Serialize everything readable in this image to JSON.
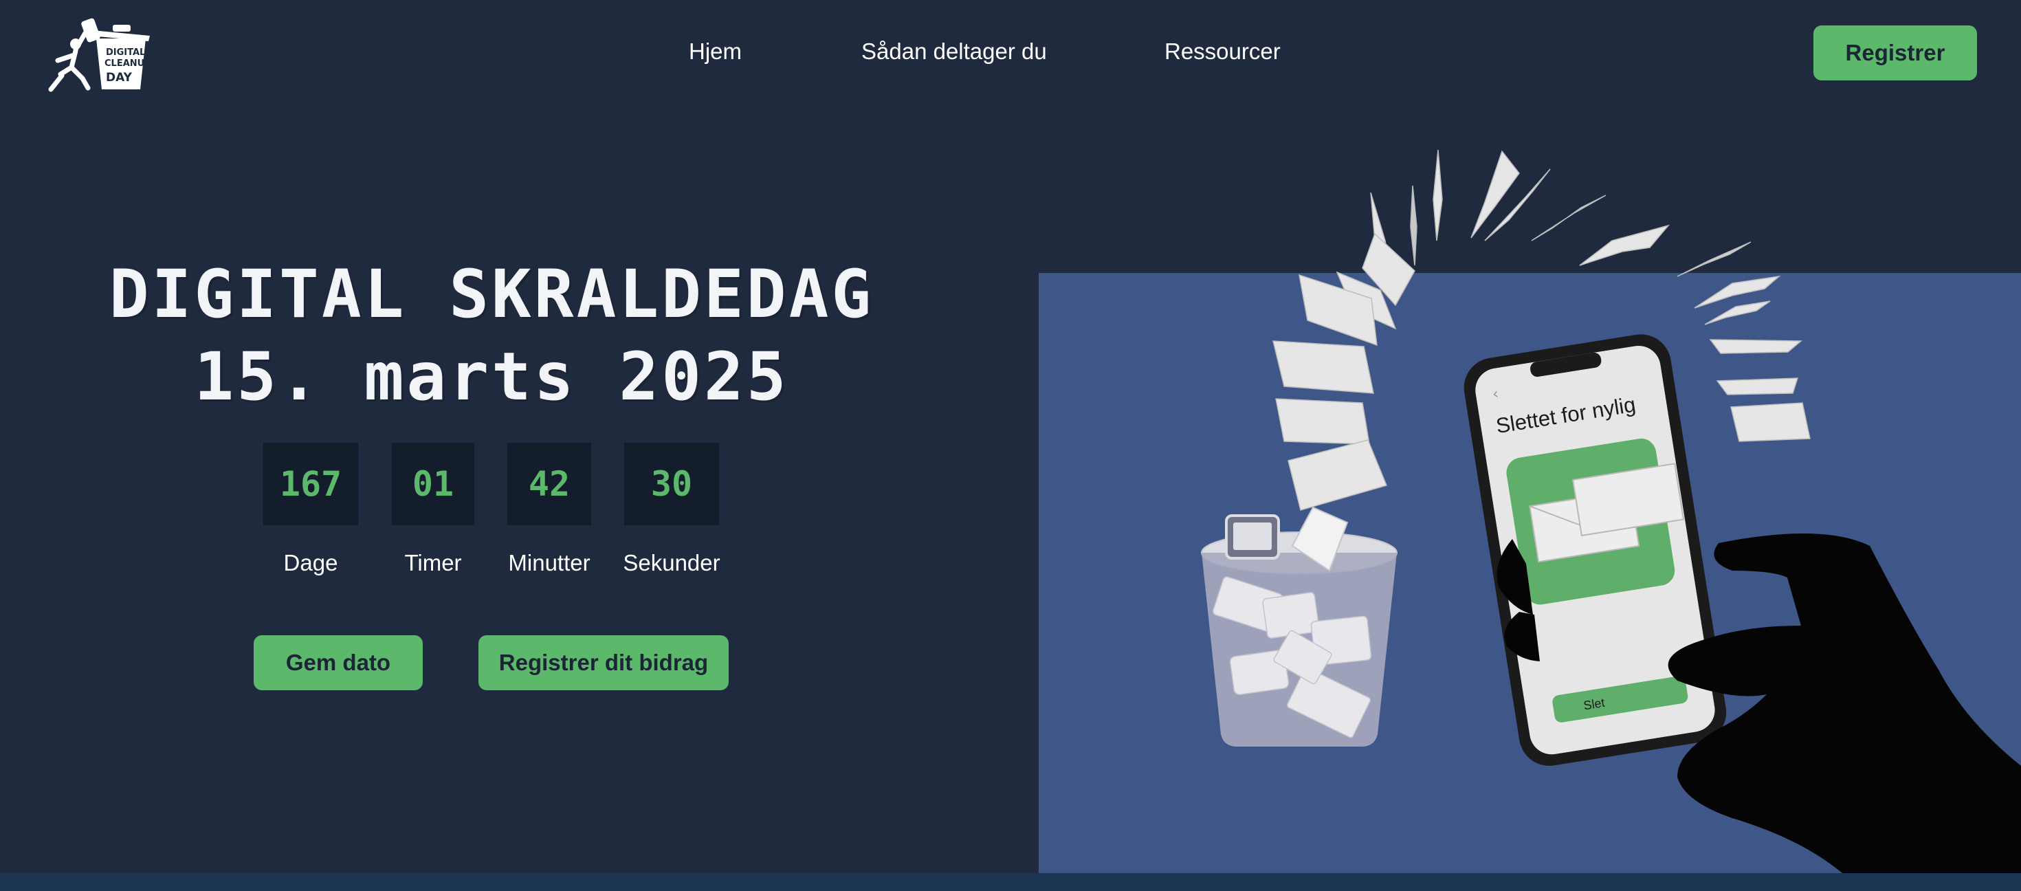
{
  "nav": {
    "logo_alt": "Digital Cleanup Day",
    "logo_text": [
      "DIGITAL",
      "CLEANUP",
      "DAY"
    ],
    "links": [
      "Hjem",
      "Sådan deltager du",
      "Ressourcer"
    ],
    "register_label": "Registrer"
  },
  "hero": {
    "title_line1": "DIGITAL SKRALDEDAG",
    "title_line2": "15. marts 2025",
    "countdown": [
      {
        "value": "167",
        "label": "Dage"
      },
      {
        "value": "01",
        "label": "Timer"
      },
      {
        "value": "42",
        "label": "Minutter"
      },
      {
        "value": "30",
        "label": "Sekunder"
      }
    ],
    "save_date_label": "Gem dato",
    "register_contribution_label": "Registrer dit bidrag"
  },
  "illustration": {
    "phone_title": "Slettet for nylig",
    "phone_button": "Slet"
  },
  "colors": {
    "background": "#1f2a3e",
    "accent": "#5cb86a",
    "panel": "#3f5688",
    "countdown_bg": "#141d2b"
  }
}
